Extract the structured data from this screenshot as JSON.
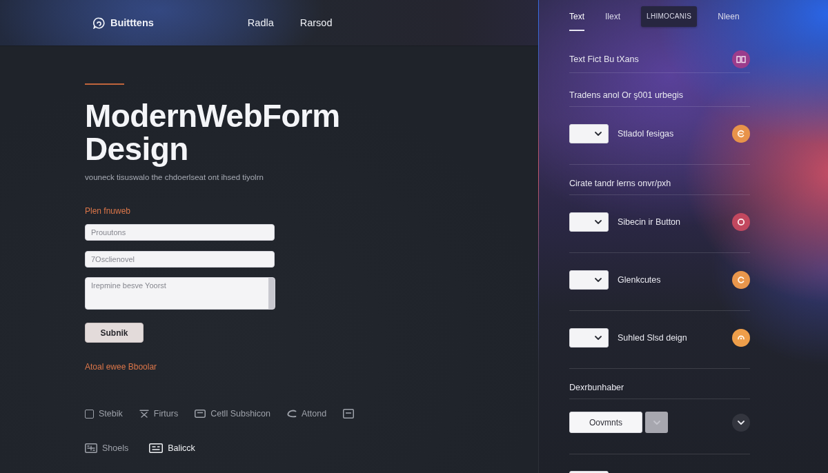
{
  "brand": {
    "name": "Buitttens"
  },
  "nav": [
    {
      "label": "Radla"
    },
    {
      "label": "Rarsod"
    }
  ],
  "hero": {
    "title": "ModernWebForm Design",
    "subtitle": "vouneck tisuswalo the chdoerlseat ont ihsed tiyolrn"
  },
  "form": {
    "label": "Plen fnuweb",
    "fields": [
      {
        "kind": "input",
        "placeholder": "Prouutons"
      },
      {
        "kind": "input",
        "placeholder": "7Osclienovel"
      },
      {
        "kind": "textarea",
        "placeholder": "Irepmine besve Yoorst"
      }
    ],
    "submit": "Subnik",
    "link": "Atoal ewee Bboolar"
  },
  "toolbar": {
    "rows": [
      {
        "items": [
          {
            "kind": "checkbox",
            "label": "Stebik",
            "checked": false,
            "selected": false
          },
          {
            "kind": "link",
            "label": "Firturs",
            "selected": false
          },
          {
            "kind": "link",
            "label": "Cetll Subshicon",
            "selected": false
          },
          {
            "kind": "link",
            "label": "Attond",
            "selected": false
          },
          {
            "kind": "icon",
            "selected": false
          }
        ]
      },
      {
        "items": [
          {
            "kind": "link",
            "label": "Shoels",
            "selected": false
          },
          {
            "kind": "link",
            "label": "Balicck",
            "selected": true
          }
        ]
      }
    ]
  },
  "side_panel": {
    "tabs": [
      {
        "label": "Text",
        "kind": "plain",
        "selected": true
      },
      {
        "label": "Ilext",
        "kind": "plain",
        "selected": false
      },
      {
        "label": "LHIMOCANIS",
        "kind": "pill",
        "selected": false
      },
      {
        "label": "Nleen",
        "kind": "plain",
        "selected": false
      }
    ],
    "rows": [
      {
        "kind": "icon_row",
        "label": "Text Fict Bu tXans",
        "color": "#9b3c8c"
      },
      {
        "kind": "text_row",
        "label": "Tradens anol Or ş001 urbegis"
      },
      {
        "kind": "select_row",
        "label": "Stladol fesigas",
        "color": "#e8934a"
      },
      {
        "kind": "heading",
        "label": "Cirate tandr lerns onvr/pxh"
      },
      {
        "kind": "select_row",
        "label": "Sibecin ir Button",
        "color": "#c2485f"
      },
      {
        "kind": "select_row",
        "label": "Glenkcutes",
        "color": "#e9964c"
      },
      {
        "kind": "select_row",
        "label": "Suhled Slsd deign",
        "color": "#ee9e4a"
      },
      {
        "kind": "heading",
        "label": "Dexrbunhaber"
      },
      {
        "kind": "button_row",
        "button": "Oovmnts"
      },
      {
        "kind": "select_only"
      }
    ]
  }
}
